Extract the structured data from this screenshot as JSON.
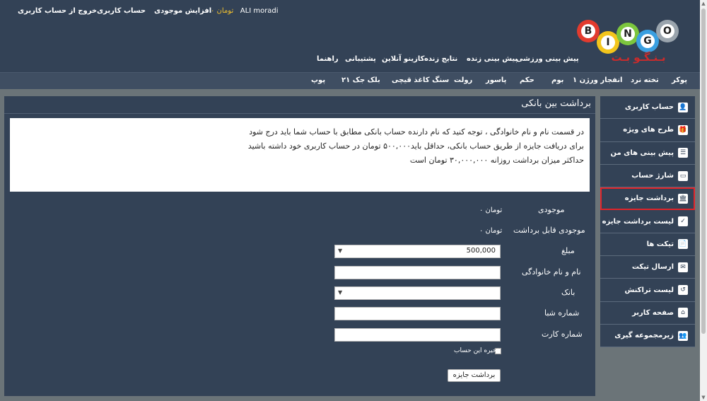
{
  "header": {
    "links": [
      "خروج از حساب کاربری",
      "حساب کاربری",
      "افزایش موجودی"
    ],
    "balance": "تومان ۰",
    "username": "ALI moradi"
  },
  "logo": {
    "letters": [
      "B",
      "I",
      "N",
      "G",
      "O"
    ],
    "subtitle": "بـنـگـو بـت"
  },
  "main_nav": [
    "پیش بینی ورزشی",
    "پیش بینی زنده",
    "نتایج زنده",
    "کازینو آنلاین",
    "پشتیبانی",
    "راهنما"
  ],
  "game_nav": [
    "پوکر",
    "تخته نرد",
    "انفجار ورژن ۱",
    "بوم",
    "حکم",
    "پاسور",
    "رولت",
    "سنگ کاغذ قیچی",
    "بلک جک ۲۱",
    "پوپ"
  ],
  "sidebar": [
    {
      "label": "حساب کاربری",
      "icon": "user-icon",
      "glyph": "👤"
    },
    {
      "label": "طرح های ویژه",
      "icon": "gift-icon",
      "glyph": "🎁"
    },
    {
      "label": "پیش بینی های من",
      "icon": "list-icon",
      "glyph": "☰"
    },
    {
      "label": "شارژ حساب",
      "icon": "credit-card-icon",
      "glyph": "▭"
    },
    {
      "label": "برداشت جایزه",
      "icon": "bank-icon",
      "glyph": "🏛"
    },
    {
      "label": "لیست برداشت جایزه",
      "icon": "calendar-check-icon",
      "glyph": "✓"
    },
    {
      "label": "تیکت ها",
      "icon": "file-icon",
      "glyph": "📄"
    },
    {
      "label": "ارسال تیکت",
      "icon": "envelope-open-icon",
      "glyph": "✉"
    },
    {
      "label": "لیست تراکنش",
      "icon": "history-icon",
      "glyph": "↺"
    },
    {
      "label": "صفحه کاربر",
      "icon": "home-icon",
      "glyph": "⌂"
    },
    {
      "label": "زیرمجموعه گیری",
      "icon": "users-icon",
      "glyph": "👥"
    }
  ],
  "panel": {
    "title": "برداشت بین بانکی",
    "notice": [
      "در قسمت نام و نام خانوادگی ، توجه کنید که نام دارنده حساب بانکی مطابق با حساب شما باید درج شود",
      "برای دریافت جایزه از طریق حساب بانکی، حداقل باید۵۰۰,۰۰۰ تومان در حساب کاربری خود داشته باشید",
      "حداکثر میزان برداشت روزانه ۳۰,۰۰۰,۰۰۰ تومان است"
    ]
  },
  "form": {
    "balance_label": "موجودی",
    "balance_value": "تومان ۰",
    "withdrawable_label": "موجودی قابل برداشت",
    "withdrawable_value": "تومان ۰",
    "amount_label": "مبلغ",
    "amount_value": "500,000",
    "name_label": "نام و نام خانوادگی",
    "bank_label": "بانک",
    "sheba_label": "شماره شبا",
    "card_label": "شماره کارت",
    "save_label": "ذخیره این حساب",
    "submit_label": "برداشت جایزه"
  },
  "colors": {
    "header_bg": "#334256",
    "accent_balance": "#f2c12e",
    "active_outline": "#e0242a"
  }
}
